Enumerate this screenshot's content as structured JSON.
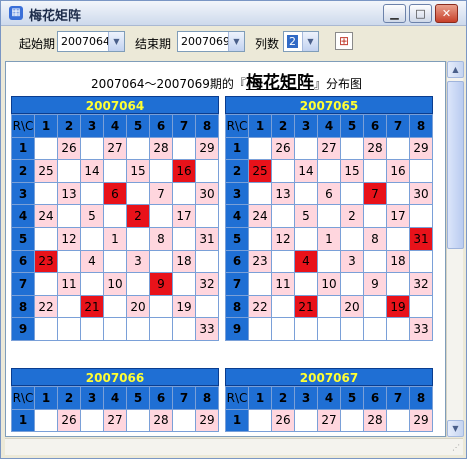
{
  "window": {
    "title": "梅花矩阵",
    "min": "▁",
    "max": "□",
    "close": "✕"
  },
  "toolbar": {
    "start_label": "起始期",
    "start_value": "2007064",
    "end_label": "结束期",
    "end_value": "2007069",
    "cols_label": "列数",
    "cols_value": "2",
    "grid_icon": "grid-icon"
  },
  "heading": {
    "prefix": "2007064～2007069期的『",
    "title": "梅花矩阵",
    "suffix": "』分布图"
  },
  "header_row": [
    "R\\C",
    "1",
    "2",
    "3",
    "4",
    "5",
    "6",
    "7",
    "8"
  ],
  "periods": [
    {
      "name": "2007064",
      "rows": [
        {
          "r": "1",
          "cells": [
            "",
            "26",
            "",
            "27",
            "",
            "28",
            "",
            "29"
          ],
          "red": []
        },
        {
          "r": "2",
          "cells": [
            "25",
            "",
            "14",
            "",
            "15",
            "",
            "16",
            ""
          ],
          "red": [
            6
          ]
        },
        {
          "r": "3",
          "cells": [
            "",
            "13",
            "",
            "6",
            "",
            "7",
            "",
            "30"
          ],
          "red": [
            3
          ]
        },
        {
          "r": "4",
          "cells": [
            "24",
            "",
            "5",
            "",
            "2",
            "",
            "17",
            ""
          ],
          "red": [
            4
          ]
        },
        {
          "r": "5",
          "cells": [
            "",
            "12",
            "",
            "1",
            "",
            "8",
            "",
            "31"
          ],
          "red": []
        },
        {
          "r": "6",
          "cells": [
            "23",
            "",
            "4",
            "",
            "3",
            "",
            "18",
            ""
          ],
          "red": [
            0
          ]
        },
        {
          "r": "7",
          "cells": [
            "",
            "11",
            "",
            "10",
            "",
            "9",
            "",
            "32"
          ],
          "red": [
            5
          ]
        },
        {
          "r": "8",
          "cells": [
            "22",
            "",
            "21",
            "",
            "20",
            "",
            "19",
            ""
          ],
          "red": [
            2
          ]
        },
        {
          "r": "9",
          "cells": [
            "",
            "",
            "",
            "",
            "",
            "",
            "",
            "33"
          ],
          "red": []
        }
      ]
    },
    {
      "name": "2007065",
      "rows": [
        {
          "r": "1",
          "cells": [
            "",
            "26",
            "",
            "27",
            "",
            "28",
            "",
            "29"
          ],
          "red": []
        },
        {
          "r": "2",
          "cells": [
            "25",
            "",
            "14",
            "",
            "15",
            "",
            "16",
            ""
          ],
          "red": [
            0
          ]
        },
        {
          "r": "3",
          "cells": [
            "",
            "13",
            "",
            "6",
            "",
            "7",
            "",
            "30"
          ],
          "red": [
            5
          ]
        },
        {
          "r": "4",
          "cells": [
            "24",
            "",
            "5",
            "",
            "2",
            "",
            "17",
            ""
          ],
          "red": []
        },
        {
          "r": "5",
          "cells": [
            "",
            "12",
            "",
            "1",
            "",
            "8",
            "",
            "31"
          ],
          "red": [
            7
          ]
        },
        {
          "r": "6",
          "cells": [
            "23",
            "",
            "4",
            "",
            "3",
            "",
            "18",
            ""
          ],
          "red": [
            2
          ]
        },
        {
          "r": "7",
          "cells": [
            "",
            "11",
            "",
            "10",
            "",
            "9",
            "",
            "32"
          ],
          "red": []
        },
        {
          "r": "8",
          "cells": [
            "22",
            "",
            "21",
            "",
            "20",
            "",
            "19",
            ""
          ],
          "red": [
            2,
            6
          ]
        },
        {
          "r": "9",
          "cells": [
            "",
            "",
            "",
            "",
            "",
            "",
            "",
            "33"
          ],
          "red": []
        }
      ]
    },
    {
      "name": "2007066",
      "rows": [
        {
          "r": "1",
          "cells": [
            "",
            "26",
            "",
            "27",
            "",
            "28",
            "",
            "29"
          ],
          "red": []
        }
      ]
    },
    {
      "name": "2007067",
      "rows": [
        {
          "r": "1",
          "cells": [
            "",
            "26",
            "",
            "27",
            "",
            "28",
            "",
            "29"
          ],
          "red": []
        }
      ]
    }
  ],
  "colors": {
    "header_blue": "#1f6fd4",
    "header_text": "#ffff33",
    "pink": "#ffd6de",
    "red": "#e8121a"
  }
}
